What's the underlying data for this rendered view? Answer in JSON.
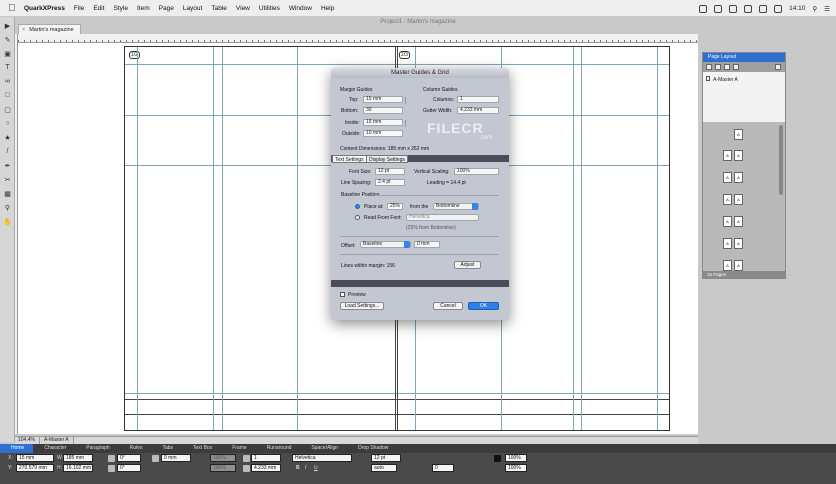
{
  "menubar": {
    "app_name": "QuarkXPress",
    "items": [
      "File",
      "Edit",
      "Style",
      "Item",
      "Page",
      "Layout",
      "Table",
      "View",
      "Utilities",
      "Window",
      "Help"
    ],
    "clock": "14:10"
  },
  "window": {
    "title": "Project1 : Martin's magazine"
  },
  "tab": {
    "label": "Martin's magazine"
  },
  "page_numbers": {
    "left": "1/2",
    "right": "2/3"
  },
  "dialog": {
    "title": "Master Guides & Grid",
    "margin_guides": {
      "heading": "Margin Guides",
      "top_label": "Top:",
      "top_value": "15 mm",
      "bottom_label": "Bottom:",
      "bottom_value": "30",
      "inside_label": "Inside:",
      "inside_value": "15 mm",
      "outside_label": "Outside:",
      "outside_value": "10 mm"
    },
    "column_guides": {
      "heading": "Column Guides",
      "columns_label": "Columns:",
      "columns_value": "1",
      "gutter_label": "Gutter Width:",
      "gutter_value": "4.233 mm"
    },
    "content_dimensions": "Content Dimensions: 185 mm x 262 mm",
    "tabs": [
      "Text Settings",
      "Display Settings"
    ],
    "text_settings": {
      "font_size_label": "Font Size:",
      "font_size_value": "12 pt",
      "vertical_scaling_label": "Vertical Scaling:",
      "vertical_scaling_value": "100%",
      "line_spacing_label": "Line Spacing:",
      "line_spacing_value": "2.4 pt",
      "leading_text": "Leading = 14.4 pt",
      "baseline_heading": "Baseline Position",
      "place_at_label": "Place at:",
      "place_at_value": "25%",
      "from_the_label": "from the",
      "from_the_value": "Bottomline",
      "read_from_font_label": "Read From Font:",
      "read_from_font_value": "Helvetica",
      "read_from_note": "(25% from Bottomline)",
      "offset_label": "Offset:",
      "offset_select": "Baseline",
      "offset_value": "0 mm",
      "lines_within_margin": "Lines within margin: 156",
      "adjust_label": "Adjust"
    },
    "preview_label": "Preview",
    "load_settings_label": "Load Settings...",
    "cancel_label": "Cancel",
    "ok_label": "OK"
  },
  "watermark": {
    "main": "FILECR",
    "sub": ".com"
  },
  "page_layout": {
    "title": "Page Layout",
    "master": "A-Master A",
    "footer": "16 Pages",
    "page_label": "A"
  },
  "statusbar": {
    "zoom": "104.4%",
    "master": "A-Master A"
  },
  "measurements": {
    "tabs": [
      "Home",
      "Character",
      "Paragraph",
      "Rules",
      "Tabs",
      "Text Box",
      "Frame",
      "Runaround",
      "Space/Align",
      "Drop Shadow"
    ],
    "x_label": "X:",
    "x_value": "15 mm",
    "y_label": "Y:",
    "y_value": "270.579 mm",
    "w_label": "W:",
    "w_value": "185 mm",
    "h_label": "H:",
    "h_value": "16.102 mm",
    "angle1": "0°",
    "angle2": "0°",
    "inset": "0 mm",
    "scale1": "100%",
    "scale2": "100%",
    "columns": "1",
    "gutter": "4.233 mm",
    "font": "Helvetica",
    "style": "Regular",
    "size": "12 pt",
    "leading": "auto",
    "tracking": "0",
    "shade1": "100%",
    "shade2": "100%"
  }
}
